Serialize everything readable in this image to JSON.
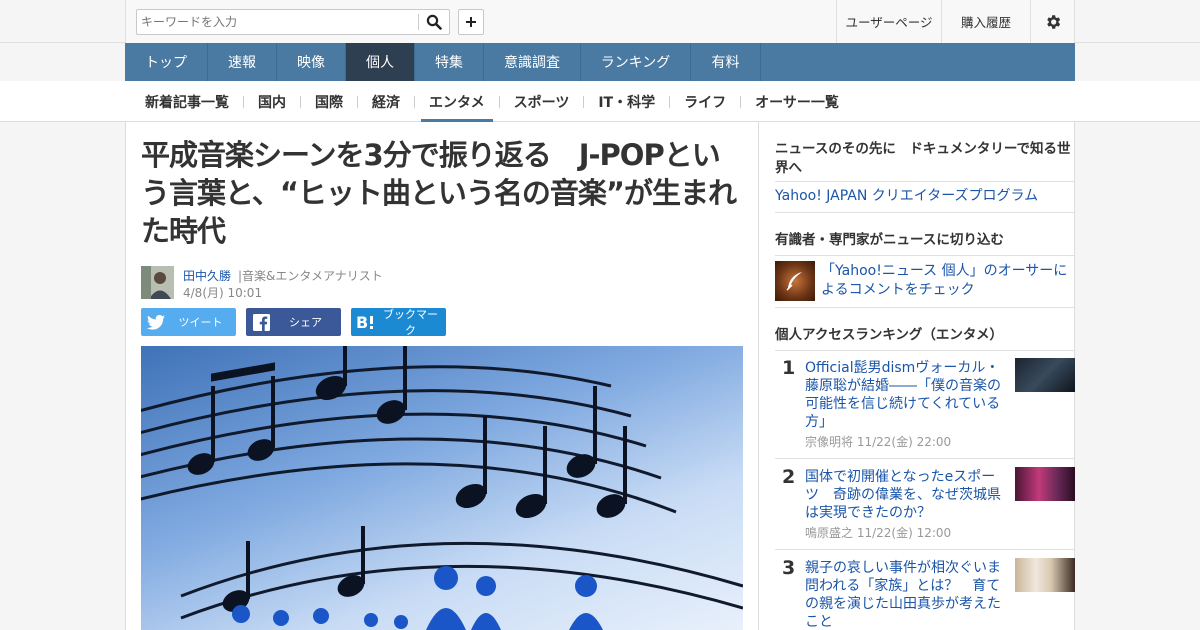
{
  "topbar": {
    "search_placeholder": "キーワードを入力",
    "user_page": "ユーザーページ",
    "purchase_history": "購入履歴"
  },
  "mainnav": {
    "items": [
      {
        "label": "トップ",
        "active": false
      },
      {
        "label": "速報",
        "active": false
      },
      {
        "label": "映像",
        "active": false
      },
      {
        "label": "個人",
        "active": true
      },
      {
        "label": "特集",
        "active": false
      },
      {
        "label": "意識調査",
        "active": false
      },
      {
        "label": "ランキング",
        "active": false
      },
      {
        "label": "有料",
        "active": false
      }
    ]
  },
  "subnav": {
    "items": [
      {
        "label": "新着記事一覧",
        "active": false
      },
      {
        "label": "国内",
        "active": false
      },
      {
        "label": "国際",
        "active": false
      },
      {
        "label": "経済",
        "active": false
      },
      {
        "label": "エンタメ",
        "active": true
      },
      {
        "label": "スポーツ",
        "active": false
      },
      {
        "label": "IT・科学",
        "active": false
      },
      {
        "label": "ライフ",
        "active": false
      },
      {
        "label": "オーサー一覧",
        "active": false
      }
    ]
  },
  "article": {
    "title": "平成音楽シーンを3分で振り返る　J-POPという言葉と、“ヒット曲という名の音楽”が生まれた時代",
    "author_name": "田中久勝",
    "author_role": "|音楽&エンタメアナリスト",
    "date": "4/8(月) 10:01",
    "share": {
      "tweet": "ツイート",
      "facebook": "シェア",
      "hatena": "ブックマーク"
    }
  },
  "sidebar": {
    "doc_heading": "ニュースのその先に　ドキュメンタリーで知る世界へ",
    "doc_link": "Yahoo! JAPAN クリエイターズプログラム",
    "expert_heading": "有識者・専門家がニュースに切り込む",
    "expert_link": "「Yahoo!ニュース 個人」のオーサーによるコメントをチェック",
    "ranking_heading": "個人アクセスランキング（エンタメ）",
    "ranking": [
      {
        "rank": "1",
        "title": "Official髭男dismヴォーカル・藤原聡が結婚――「僕の音楽の可能性を信じ続けてくれている方」",
        "meta": "宗像明将  11/22(金) 22:00"
      },
      {
        "rank": "2",
        "title": "国体で初開催となったeスポーツ　奇跡の偉業を、なぜ茨城県は実現できたのか？",
        "meta": "鳴原盛之  11/22(金) 12:00"
      },
      {
        "rank": "3",
        "title": "親子の哀しい事件が相次ぐいま問われる「家族」とは？　育ての親を演じた山田真歩が考えたこと",
        "meta": ""
      }
    ]
  }
}
